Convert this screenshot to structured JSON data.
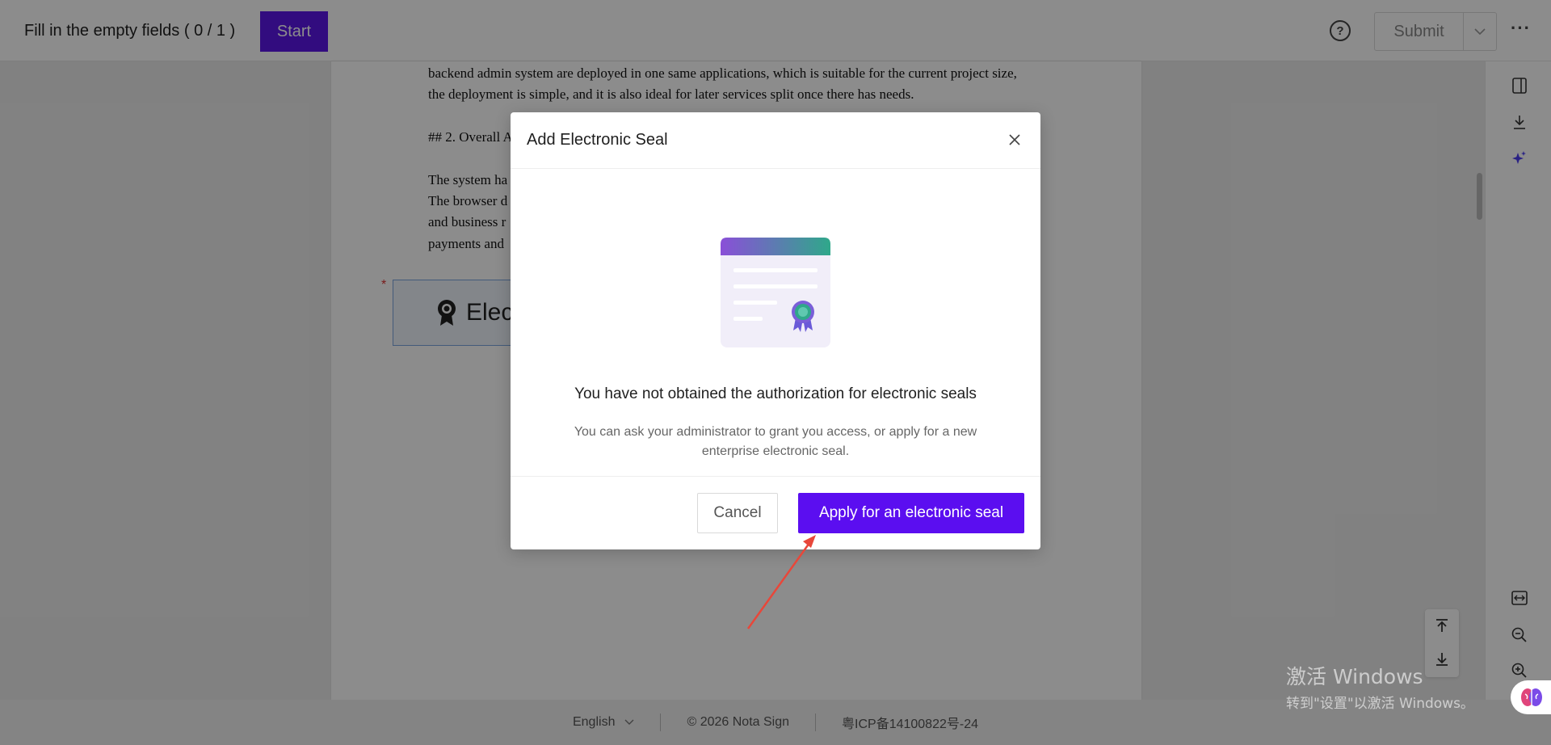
{
  "header": {
    "fill_label": "Fill in the empty fields ( 0 / 1 )",
    "start_label": "Start",
    "submit_label": "Submit"
  },
  "document": {
    "lines": [
      "backend admin system are deployed in one same applications, which is suitable for the current project size,",
      "the deployment is simple, and it is also ideal for later services split once there has needs.",
      "## 2. Overall A",
      "The system ha",
      "The browser d",
      "and business r",
      "payments and"
    ],
    "seal_field_label": "Elec"
  },
  "modal": {
    "title": "Add Electronic Seal",
    "message": "You have not obtained the authorization for electronic seals",
    "sub_message": "You can ask your administrator to grant you access, or apply for a new enterprise electronic seal.",
    "cancel_label": "Cancel",
    "apply_label": "Apply for an electronic seal"
  },
  "footer": {
    "language": "English",
    "copyright": "© 2026 Nota Sign",
    "icp": "粤ICP备14100822号-24"
  },
  "watermark": {
    "line1": "激活 Windows",
    "line2": "转到\"设置\"以激活 Windows。"
  },
  "colors": {
    "accent": "#5b0ef0",
    "annotation_arrow": "#e8473a"
  }
}
